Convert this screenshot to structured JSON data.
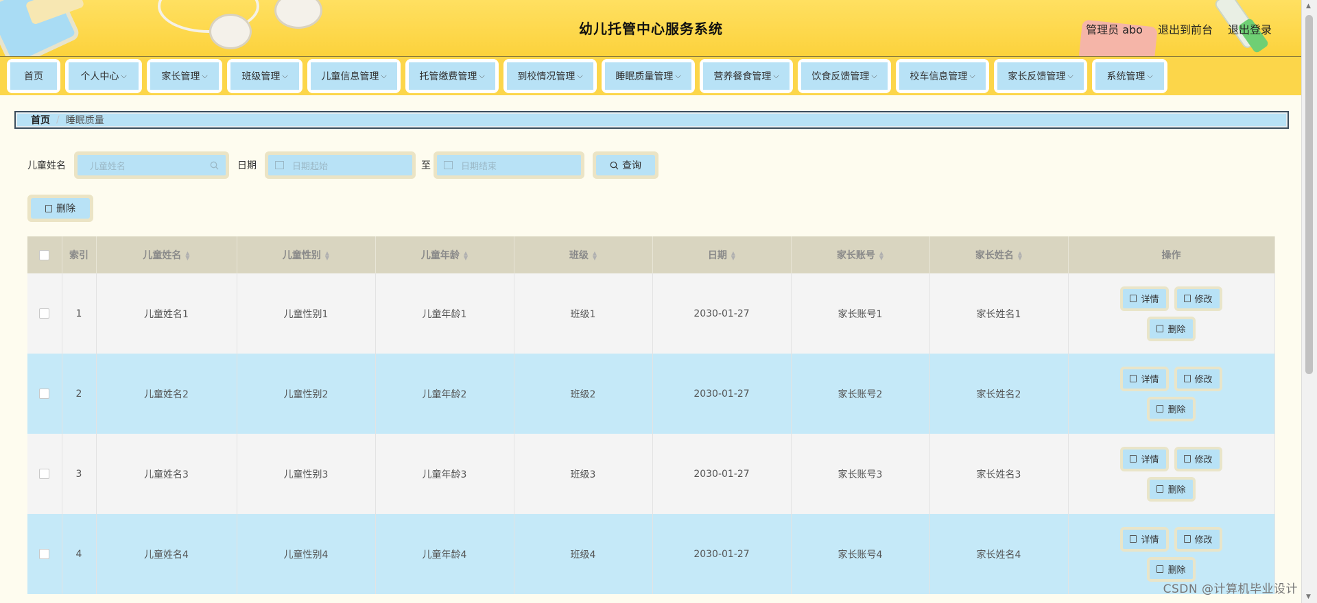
{
  "header": {
    "title": "幼儿托管中心服务系统",
    "user_label": "管理员 abo",
    "to_front_label": "退出到前台",
    "logout_label": "退出登录"
  },
  "nav": [
    {
      "label": "首页",
      "dropdown": false
    },
    {
      "label": "个人中心",
      "dropdown": true
    },
    {
      "label": "家长管理",
      "dropdown": true
    },
    {
      "label": "班级管理",
      "dropdown": true
    },
    {
      "label": "儿童信息管理",
      "dropdown": true
    },
    {
      "label": "托管缴费管理",
      "dropdown": true
    },
    {
      "label": "到校情况管理",
      "dropdown": true
    },
    {
      "label": "睡眠质量管理",
      "dropdown": true
    },
    {
      "label": "营养餐食管理",
      "dropdown": true
    },
    {
      "label": "饮食反馈管理",
      "dropdown": true
    },
    {
      "label": "校车信息管理",
      "dropdown": true
    },
    {
      "label": "家长反馈管理",
      "dropdown": true
    },
    {
      "label": "系统管理",
      "dropdown": true
    }
  ],
  "breadcrumb": {
    "home": "首页",
    "current": "睡眠质量"
  },
  "search": {
    "name_label": "儿童姓名",
    "name_placeholder": "儿童姓名",
    "date_label": "日期",
    "start_placeholder": "日期起始",
    "to_label": "至",
    "end_placeholder": "日期结束",
    "query_label": "查询"
  },
  "toolbar": {
    "delete_label": "删除"
  },
  "table": {
    "columns": [
      "索引",
      "儿童姓名",
      "儿童性别",
      "儿童年龄",
      "班级",
      "日期",
      "家长账号",
      "家长姓名",
      "操作"
    ],
    "rows": [
      {
        "index": "1",
        "name": "儿童姓名1",
        "gender": "儿童性别1",
        "age": "儿童年龄1",
        "class": "班级1",
        "date": "2030-01-27",
        "account": "家长账号1",
        "parent": "家长姓名1"
      },
      {
        "index": "2",
        "name": "儿童姓名2",
        "gender": "儿童性别2",
        "age": "儿童年龄2",
        "class": "班级2",
        "date": "2030-01-27",
        "account": "家长账号2",
        "parent": "家长姓名2"
      },
      {
        "index": "3",
        "name": "儿童姓名3",
        "gender": "儿童性别3",
        "age": "儿童年龄3",
        "class": "班级3",
        "date": "2030-01-27",
        "account": "家长账号3",
        "parent": "家长姓名3"
      },
      {
        "index": "4",
        "name": "儿童姓名4",
        "gender": "儿童性别4",
        "age": "儿童年龄4",
        "class": "班级4",
        "date": "2030-01-27",
        "account": "家长账号4",
        "parent": "家长姓名4"
      }
    ],
    "actions": {
      "detail": "详情",
      "edit": "修改",
      "delete": "删除"
    }
  },
  "watermark": "CSDN @计算机毕业设计",
  "colors": {
    "header_bg": "#fcd23c",
    "nav_bg": "#fcd64a",
    "button_bg": "#b8e2f6",
    "row_alt": "#c5e9f8",
    "page_bg": "#fefcef"
  }
}
